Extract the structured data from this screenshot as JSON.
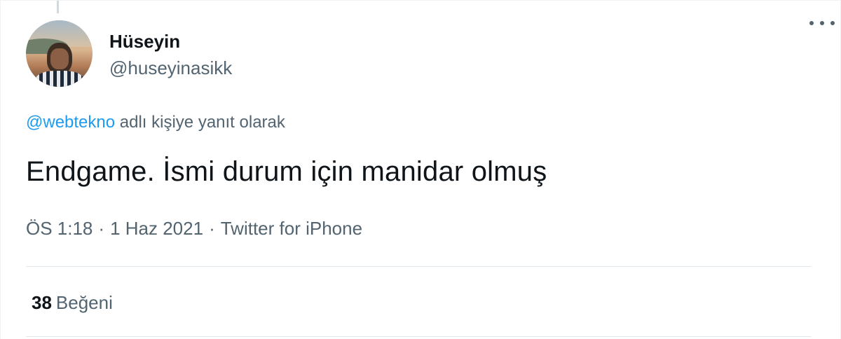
{
  "tweet": {
    "author": {
      "display_name": "Hüseyin",
      "handle": "@huseyinasikk"
    },
    "reply": {
      "mention": "@webtekno",
      "suffix": " adlı kişiye yanıt olarak"
    },
    "text": "Endgame. İsmi durum için manidar olmuş",
    "meta": {
      "time": "ÖS 1:18",
      "separator": "·",
      "date": "1 Haz 2021",
      "source": "Twitter for iPhone"
    },
    "stats": {
      "likes_count": "38",
      "likes_label": "Beğeni"
    }
  },
  "colors": {
    "link": "#1d9bf0",
    "secondary_text": "#536471",
    "primary_text": "#0f1419"
  },
  "icons": {
    "more": "more-horizontal-icon"
  }
}
